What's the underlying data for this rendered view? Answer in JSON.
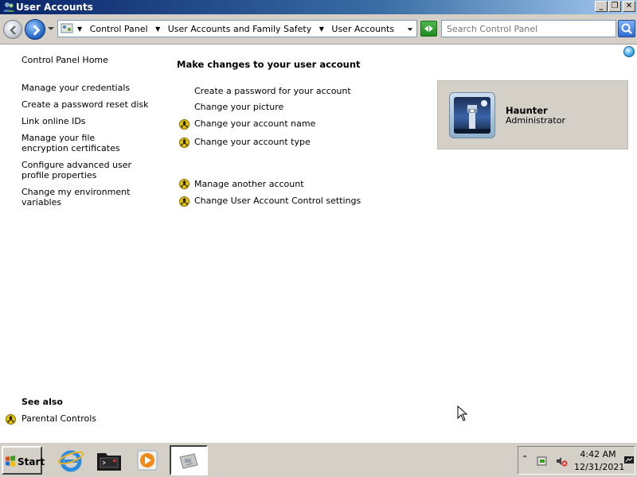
{
  "window": {
    "title": "User Accounts"
  },
  "address_bar": {
    "crumbs": [
      "Control Panel",
      "User Accounts and Family Safety",
      "User Accounts"
    ],
    "search_placeholder": "Search Control Panel"
  },
  "left_nav": {
    "home": "Control Panel Home",
    "links": [
      "Manage your credentials",
      "Create a password reset disk",
      "Link online IDs",
      "Manage your file encryption certificates",
      "Configure advanced user profile properties",
      "Change my environment variables"
    ],
    "see_also_title": "See also",
    "see_also_links": [
      "Parental Controls"
    ]
  },
  "main": {
    "heading": "Make changes to your user account",
    "tasks": [
      "Create a password for your account",
      "Change your picture",
      "Change your account name",
      "Change your account type",
      "Manage another account",
      "Change User Account Control settings"
    ]
  },
  "account": {
    "name": "Haunter",
    "role": "Administrator"
  },
  "taskbar": {
    "start_label": "Start",
    "time": "4:42 AM",
    "date": "12/31/2021"
  },
  "colors": {
    "titlebar": "#0a246a",
    "chrome": "#d4d0c8",
    "shield": "#e8c400"
  }
}
